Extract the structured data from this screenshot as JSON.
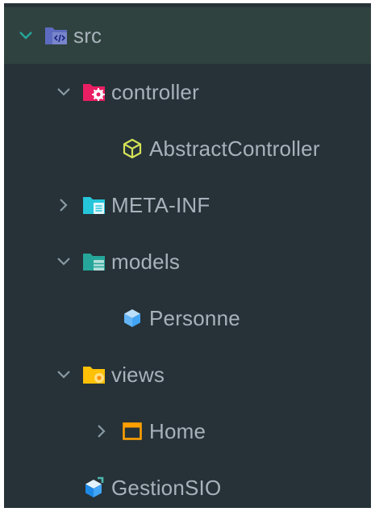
{
  "tree": {
    "src": {
      "label": "src",
      "expanded": true,
      "icon": "folder-source-icon",
      "color": "#5c6bc0"
    },
    "controller": {
      "label": "controller",
      "expanded": true,
      "icon": "folder-controller-icon",
      "color": "#e91e63"
    },
    "abstract_controller": {
      "label": "AbstractController",
      "icon": "cube-outline-icon",
      "color": "#d4e157"
    },
    "meta_inf": {
      "label": "META-INF",
      "expanded": false,
      "icon": "folder-config-icon",
      "color": "#26c6da"
    },
    "models": {
      "label": "models",
      "expanded": true,
      "icon": "folder-database-icon",
      "color": "#26a69a"
    },
    "personne": {
      "label": "Personne",
      "icon": "cube-solid-icon",
      "color": "#64b5f6"
    },
    "views": {
      "label": "views",
      "expanded": true,
      "icon": "folder-views-icon",
      "color": "#ffc107"
    },
    "home": {
      "label": "Home",
      "expanded": false,
      "icon": "window-icon",
      "color": "#ffa000"
    },
    "gestion_sio": {
      "label": "GestionSIO",
      "icon": "app-cube-icon",
      "color": "#42a5f5"
    }
  },
  "colors": {
    "background": "#263238",
    "selected_row": "#30423f",
    "text": "#a7b2bb",
    "chevron": "#8a9aa4",
    "chevron_active": "#26a69a"
  }
}
